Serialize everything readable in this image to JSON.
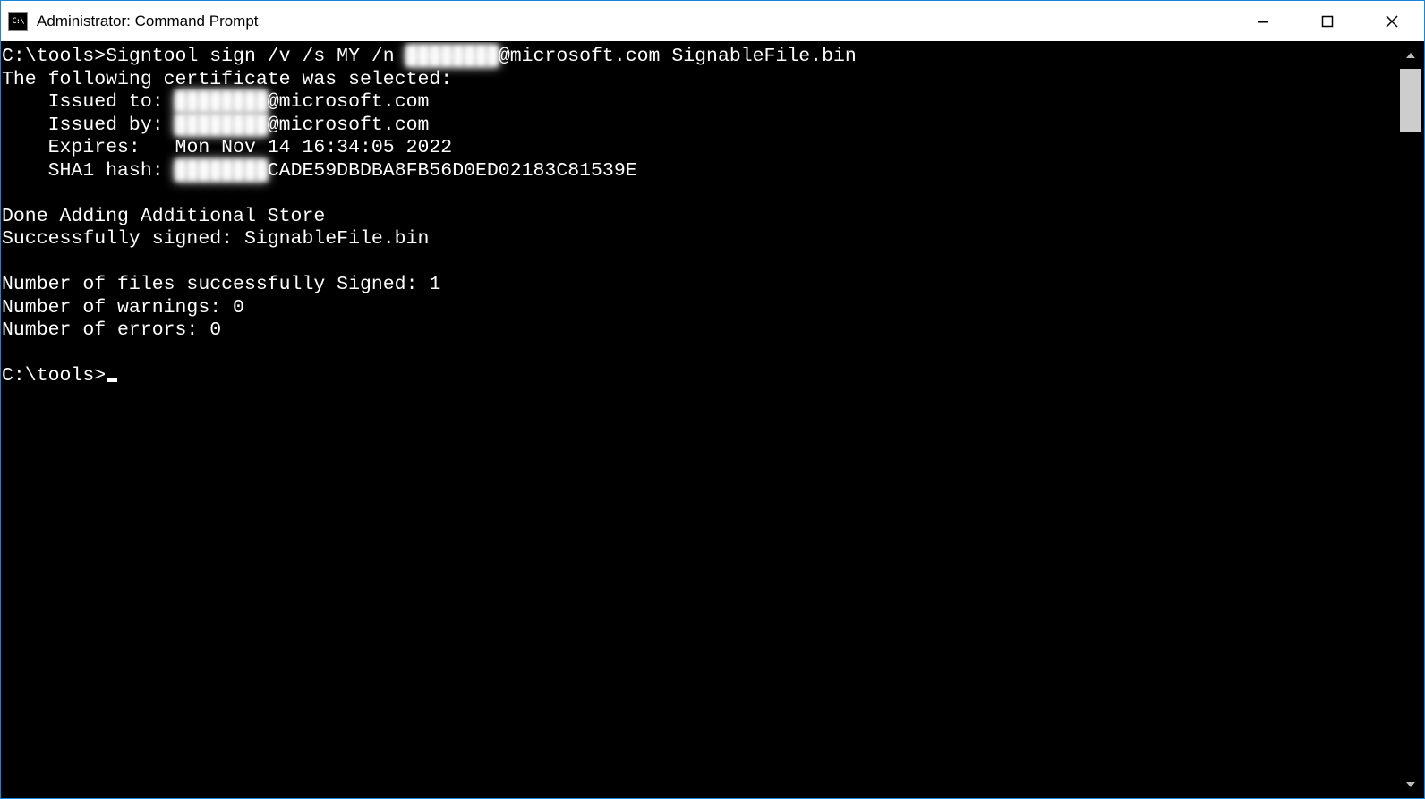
{
  "window": {
    "title": "Administrator: Command Prompt",
    "app_icon_label": "C:\\"
  },
  "terminal": {
    "prompt1": "C:\\tools>",
    "command_part1": "Signtool sign /v /s MY /n ",
    "command_redacted": "████████",
    "command_part2": "@microsoft.com SignableFile.bin",
    "cert_selected": "The following certificate was selected:",
    "issued_to_label": "    Issued to: ",
    "issued_to_redacted": "████████",
    "issued_to_value": "@microsoft.com",
    "issued_by_label": "    Issued by: ",
    "issued_by_redacted": "████████",
    "issued_by_value": "@microsoft.com",
    "expires_label": "    Expires:   ",
    "expires_value": "Mon Nov 14 16:34:05 2022",
    "sha1_label": "    SHA1 hash: ",
    "sha1_redacted": "████████",
    "sha1_value": "CADE59DBDBA8FB56D0ED02183C81539E",
    "done_store": "Done Adding Additional Store",
    "success_signed": "Successfully signed: SignableFile.bin",
    "num_signed": "Number of files successfully Signed: 1",
    "num_warnings": "Number of warnings: 0",
    "num_errors": "Number of errors: 0",
    "prompt2": "C:\\tools>"
  }
}
